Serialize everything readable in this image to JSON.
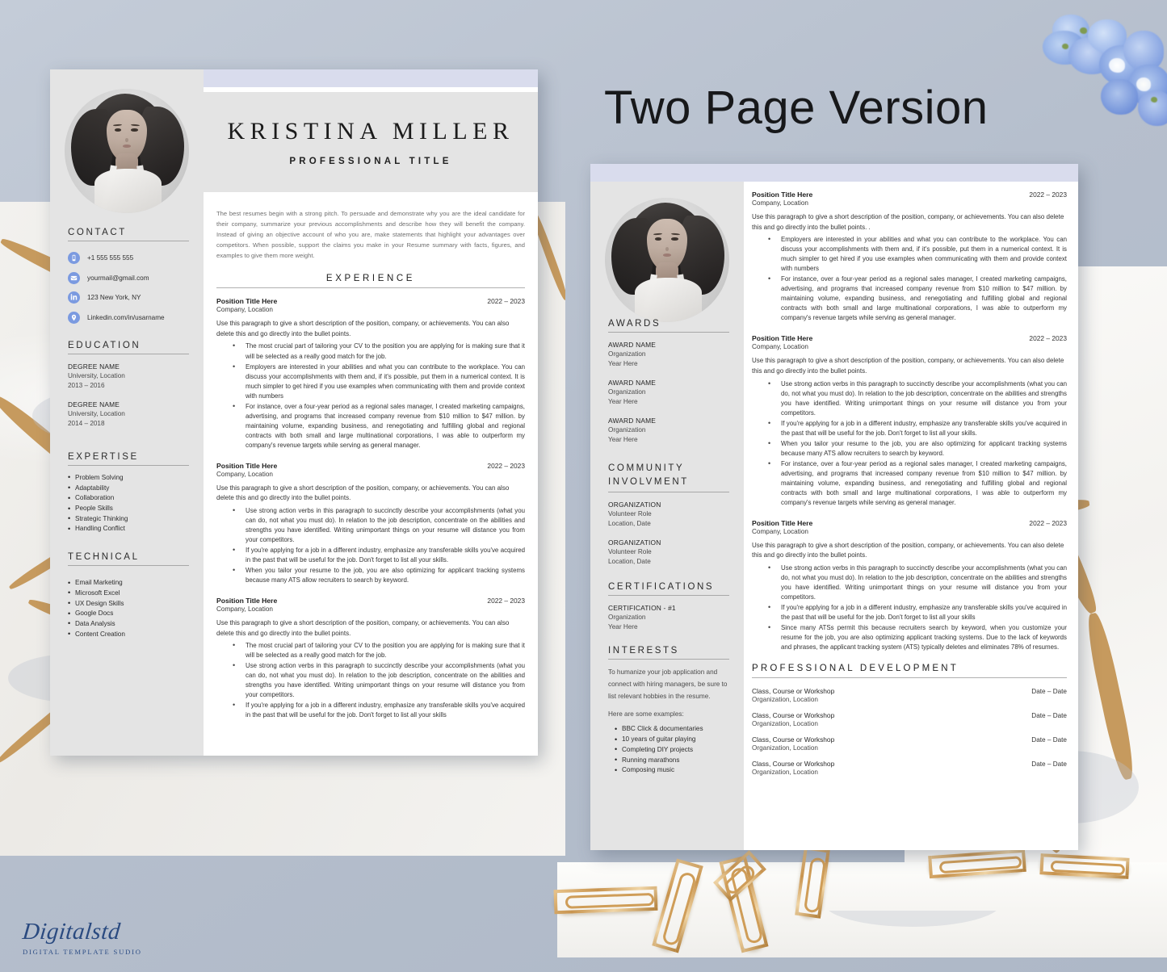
{
  "headline": "Two Page Version",
  "brand": {
    "name": "Digitalstd",
    "tagline": "DIGITAL TEMPLATE SUDIO"
  },
  "colors": {
    "accent_band": "#d9dced",
    "sidebar_bg": "#e4e4e4",
    "page_bg": "#ffffff",
    "icon_blue": "#7b9ae0",
    "canvas": "#b9c2cf",
    "gold_vein": "#c69a5e",
    "brand_blue": "#2a4a80"
  },
  "page1": {
    "header": {
      "name": "KRISTINA MILLER",
      "title": "PROFESSIONAL TITLE"
    },
    "sidebar": {
      "contact": {
        "heading": "CONTACT",
        "items": [
          {
            "icon": "phone-icon",
            "text": "+1 555 555 555"
          },
          {
            "icon": "envelope-icon",
            "text": "yourmail@gmail.com"
          },
          {
            "icon": "linkedin-icon",
            "text": "123 New York, NY"
          },
          {
            "icon": "location-pin-icon",
            "text": "Linkedin.com/in/usarname"
          }
        ]
      },
      "education": {
        "heading": "EDUCATION",
        "items": [
          {
            "degree": "DEGREE NAME",
            "school": "University, Location",
            "years": "2013 – 2016"
          },
          {
            "degree": "DEGREE NAME",
            "school": "University, Location",
            "years": "2014 – 2018"
          }
        ]
      },
      "expertise": {
        "heading": "EXPERTISE",
        "items": [
          "Problem Solving",
          "Adaptability",
          "Collaboration",
          "People Skills",
          "Strategic Thinking",
          "Handling Conflict"
        ]
      },
      "technical": {
        "heading": "TECHNICAL",
        "items": [
          "Email Marketing",
          "Microsoft Excel",
          "UX Design Skills",
          "Google Docs",
          "Data Analysis",
          "Content Creation"
        ]
      }
    },
    "summary": "The best resumes begin with a strong pitch. To persuade and demonstrate why you are the ideal candidate for their company, summarize your previous accomplishments and describe how they will benefit the company. Instead of giving an objective account of who you are, make statements that highlight your advantages over competitors. When possible, support the claims you make in your Resume summary with facts, figures, and examples to give them more weight.",
    "experience_heading": "EXPERIENCE",
    "jobs": [
      {
        "title": "Position Title Here",
        "date": "2022 – 2023",
        "company": "Company, Location",
        "desc": "Use this paragraph to give a short description of the position, company, or achievements. You can also delete this and go directly into the bullet points.",
        "bullets": [
          "The most crucial part of tailoring your CV to the position you are applying for is making sure that it will be selected as a really good match for the job.",
          "Employers are interested in your abilities and what you can contribute to the workplace. You can discuss your accomplishments with them and, if it's possible, put them in a numerical context. It is much simpler to get hired if you use examples when communicating with them and provide context with numbers",
          "For instance, over a four-year period as a regional sales manager, I created marketing campaigns, advertising, and programs that increased company revenue from $10 million to $47 million. by maintaining volume, expanding business, and renegotiating and fulfilling global and regional contracts with both small and large multinational corporations, I was able to outperform my company's revenue targets while serving as general manager."
        ]
      },
      {
        "title": "Position Title Here",
        "date": "2022 – 2023",
        "company": "Company, Location",
        "desc": "Use this paragraph to give a short description of the position, company, or achievements. You can also delete this and go directly into the bullet points.",
        "bullets": [
          "Use strong action verbs in this paragraph to succinctly describe your accomplishments (what you can do, not what you must do). In relation to the job description, concentrate on the abilities and strengths you have identified. Writing unimportant things on your resume will distance you from your competitors.",
          "If you're applying for a job in a different industry, emphasize any transferable skills you've acquired in the past that will be useful for the job. Don't forget to list all your skills.",
          "When you tailor your resume to the job, you are also optimizing for applicant tracking systems because many ATS allow recruiters to search by keyword."
        ]
      },
      {
        "title": "Position Title Here",
        "date": "2022 – 2023",
        "company": "Company, Location",
        "desc": "Use this paragraph to give a short description of the position, company, or achievements. You can also delete this and go directly into the bullet points.",
        "bullets": [
          "The most crucial part of tailoring your CV to the position you are applying for is making sure that it will be selected as a really good match for the job.",
          "Use strong action verbs in this paragraph to succinctly describe your accomplishments (what you can do, not what you must do). In relation to the job description, concentrate on the abilities and strengths you have identified. Writing unimportant things on your resume will distance you from your competitors.",
          "If you're applying for a job in a different industry, emphasize any transferable skills you've acquired in the past that will be useful for the job. Don't forget to list all your skills"
        ]
      }
    ]
  },
  "page2": {
    "sidebar": {
      "awards": {
        "heading": "AWARDS",
        "items": [
          {
            "name": "AWARD NAME",
            "org": "Organization",
            "year": "Year Here"
          },
          {
            "name": "AWARD NAME",
            "org": "Organization",
            "year": "Year Here"
          },
          {
            "name": "AWARD NAME",
            "org": "Organization",
            "year": "Year Here"
          }
        ]
      },
      "community": {
        "heading": "COMMUNITY INVOLVMENT",
        "items": [
          {
            "name": "ORGANIZATION",
            "role": "Volunteer Role",
            "where": "Location, Date"
          },
          {
            "name": "ORGANIZATION",
            "role": "Volunteer Role",
            "where": "Location, Date"
          }
        ]
      },
      "certifications": {
        "heading": "CERTIFICATIONS",
        "items": [
          {
            "name": "CERTIFICATION - #1",
            "org": "Organization",
            "year": "Year Here"
          }
        ]
      },
      "interests": {
        "heading": "INTERESTS",
        "intro": "To humanize your job application and connect with hiring managers, be sure to list relevant hobbies in the resume.",
        "examples_label": "Here are some examples:",
        "items": [
          "BBC Click & documentaries",
          "10 years of guitar playing",
          "Completing DIY projects",
          "Running marathons",
          "Composing music"
        ]
      }
    },
    "jobs": [
      {
        "title": "Position Title Here",
        "date": "2022 – 2023",
        "company": "Company, Location",
        "desc": "Use this paragraph to give a short description of the position, company, or achievements. You can also delete this and go directly into the bullet points. .",
        "bullets": [
          "Employers are interested in your abilities and what you can contribute to the workplace. You can discuss your accomplishments with them and, if it's possible, put them in a numerical context. It is much simpler to get hired if you use examples when communicating with them and provide context with numbers",
          "For instance, over a four-year period as a regional sales manager, I created marketing campaigns, advertising, and programs that increased company revenue from $10 million to $47 million. by maintaining volume, expanding business, and renegotiating and fulfilling global and regional contracts with both small and large multinational corporations, I was able to outperform my company's revenue targets while serving as general manager."
        ]
      },
      {
        "title": "Position Title Here",
        "date": "2022 – 2023",
        "company": "Company, Location",
        "desc": "Use this paragraph to give a short description of the position, company, or achievements. You can also delete this and go directly into the bullet points.",
        "bullets": [
          "Use strong action verbs in this paragraph to succinctly describe your accomplishments (what you can do, not what you must do). In relation to the job description, concentrate on the abilities and strengths you have identified. Writing unimportant things on your resume will distance you from your competitors.",
          "If you're applying for a job in a different industry, emphasize any transferable skills you've acquired in the past that will be useful for the job. Don't forget to list all your skills.",
          "When you tailor your resume to the job, you are also optimizing for applicant tracking systems because many ATS allow recruiters to search by keyword.",
          "For instance, over a four-year period as a regional sales manager, I created marketing campaigns, advertising, and programs that increased company revenue from $10 million to $47 million. by maintaining volume, expanding business, and renegotiating and fulfilling global and regional contracts with both small and large multinational corporations, I was able to outperform my company's revenue targets while serving as general manager."
        ]
      },
      {
        "title": "Position Title Here",
        "date": "2022 – 2023",
        "company": "Company, Location",
        "desc": "Use this paragraph to give a short description of the position, company, or achievements. You can also delete this and go directly into the bullet points.",
        "bullets": [
          "Use strong action verbs in this paragraph to succinctly describe your accomplishments (what you can do, not what you must do). In relation to the job description, concentrate on the abilities and strengths you have identified. Writing unimportant things on your resume will distance you from your competitors.",
          "If you're applying for a job in a different industry, emphasize any transferable skills you've acquired in the past that will be useful for the job. Don't forget to list all your skills",
          "Since many ATSs permit this because recruiters search by keyword, when you customize your resume for the job, you are also optimizing applicant tracking systems. Due to the lack of keywords and phrases, the applicant tracking system (ATS) typically deletes and eliminates 78% of resumes."
        ]
      }
    ],
    "professional_development": {
      "heading": "PROFESSIONAL DEVELOPMENT",
      "items": [
        {
          "title": "Class, Course or Workshop",
          "org": "Organization, Location",
          "date": "Date – Date"
        },
        {
          "title": "Class, Course or Workshop",
          "org": "Organization, Location",
          "date": "Date – Date"
        },
        {
          "title": "Class, Course or Workshop",
          "org": "Organization, Location",
          "date": "Date – Date"
        },
        {
          "title": "Class, Course or Workshop",
          "org": "Organization, Location",
          "date": "Date – Date"
        }
      ]
    }
  }
}
